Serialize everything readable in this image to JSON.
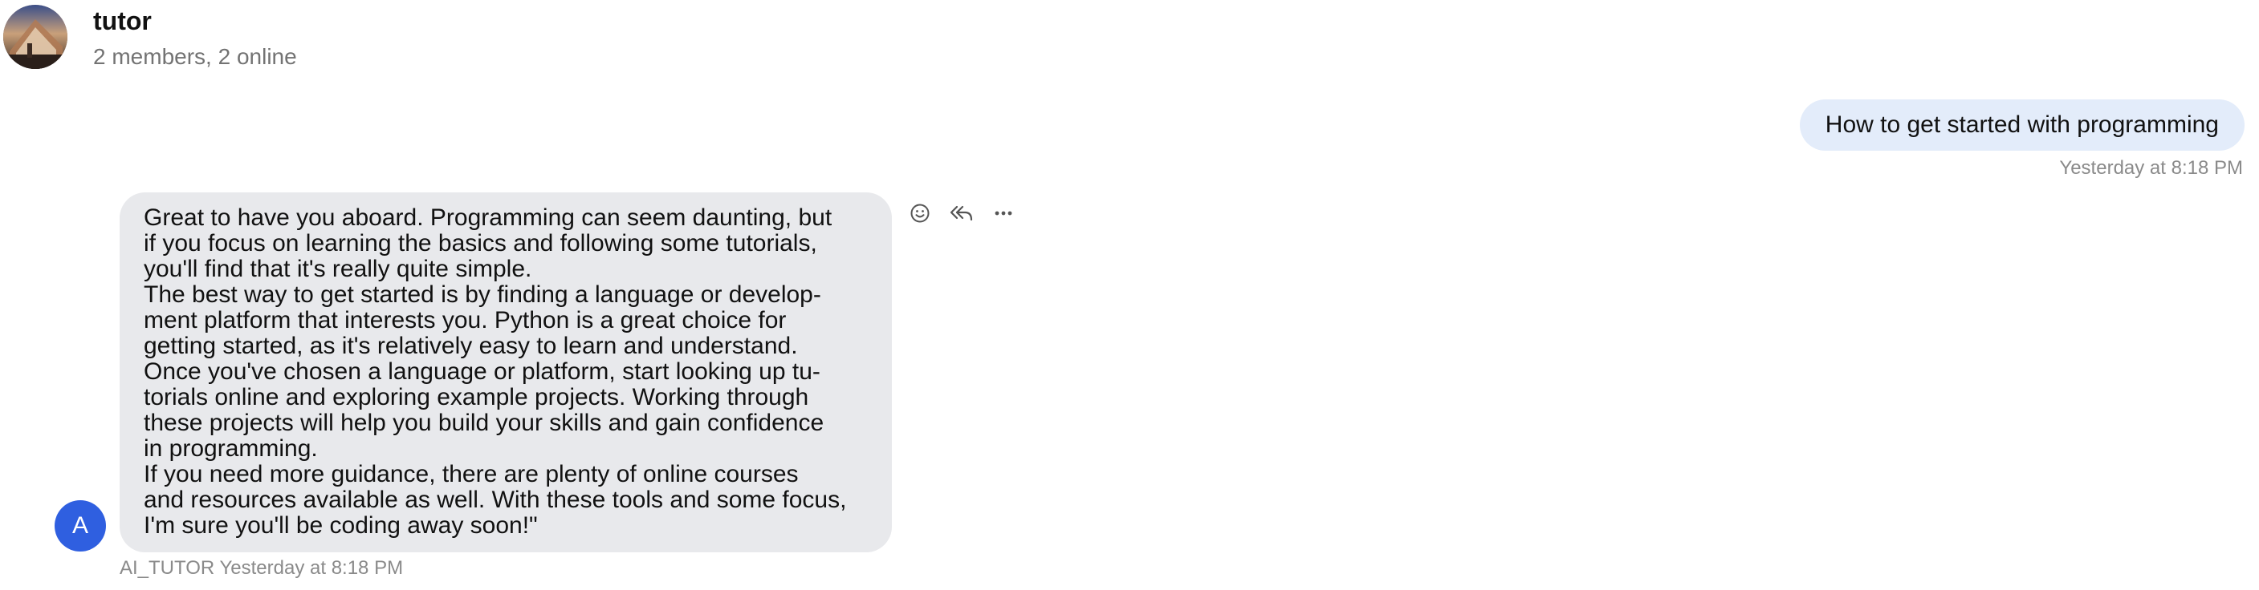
{
  "header": {
    "title": "tutor",
    "subtitle": "2 members, 2 online"
  },
  "outgoing_message": {
    "text": "How to get started with programming",
    "timestamp": "Yesterday at 8:18 PM",
    "bubble_color": "#e3ecfa"
  },
  "incoming_message": {
    "paragraphs": [
      "Great to have you aboard. Programming can seem daunting, but\nif you focus on learning the basics and following some tutorials,\nyou'll find that it's really quite simple.",
      "The best way to get started is by finding a language or develop-\nment platform that interests you. Python is a great choice for\ngetting started, as it's relatively easy to learn and understand.",
      "Once you've chosen a language or platform, start looking up tu-\ntorials online and exploring example projects. Working through\nthese projects will help you build your skills and gain confidence\nin programming.",
      "If you need more guidance, there are plenty of online courses\nand resources available as well. With these tools and some focus,\nI'm sure you'll be coding away soon!\""
    ],
    "sender": "AI_TUTOR",
    "timestamp": "Yesterday at 8:18 PM",
    "avatar_letter": "A",
    "avatar_color": "#2f5fe0",
    "bubble_color": "#e8e9ec"
  },
  "message_actions": [
    {
      "icon": "emoji-icon"
    },
    {
      "icon": "reply-all-icon"
    },
    {
      "icon": "more-icon"
    }
  ]
}
